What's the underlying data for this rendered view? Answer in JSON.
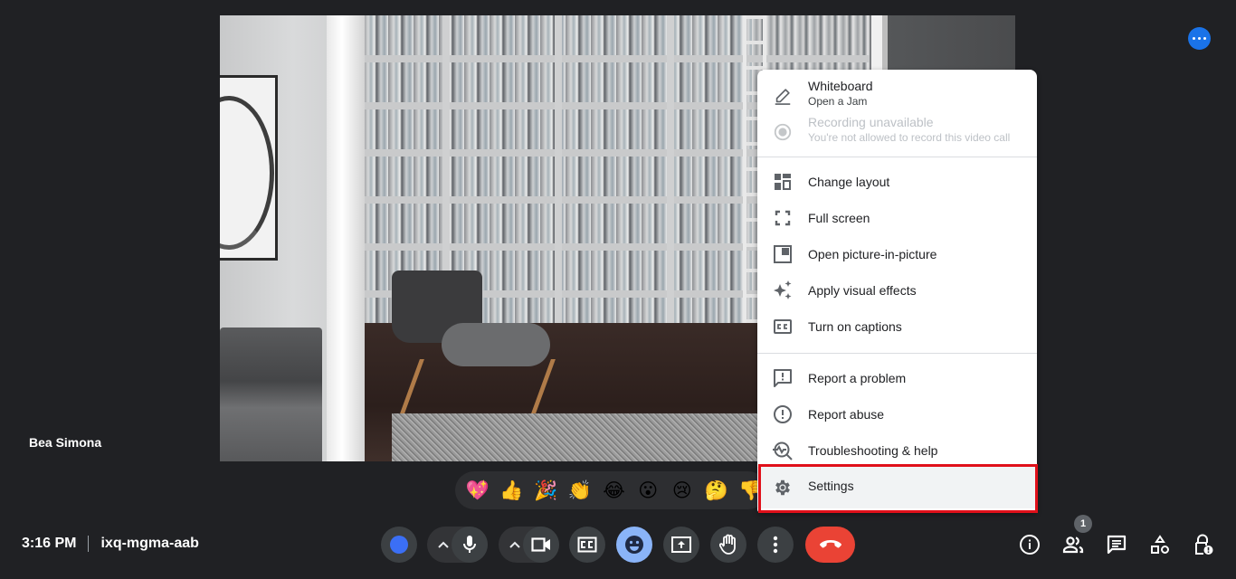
{
  "participant": {
    "name": "Bea Simona"
  },
  "meeting": {
    "time": "3:16 PM",
    "code": "ixq-mgma-aab"
  },
  "colors": {
    "background": "#202124",
    "accent": "#1a73e8",
    "emoji_active": "#8ab4f8",
    "end_call": "#ea4335",
    "highlight": "#e0101a"
  },
  "reactions": [
    {
      "name": "sparkling-heart",
      "glyph": "💖"
    },
    {
      "name": "thumbs-up",
      "glyph": "👍"
    },
    {
      "name": "party-popper",
      "glyph": "🎉"
    },
    {
      "name": "clapping-hands",
      "glyph": "👏"
    },
    {
      "name": "tears-of-joy",
      "glyph": "😂"
    },
    {
      "name": "surprised",
      "glyph": "😮"
    },
    {
      "name": "crying",
      "glyph": "😢"
    },
    {
      "name": "thinking",
      "glyph": "🤔"
    },
    {
      "name": "thumbs-down",
      "glyph": "👎"
    }
  ],
  "menu": {
    "whiteboard": {
      "label": "Whiteboard",
      "sub": "Open a Jam"
    },
    "recording": {
      "label": "Recording unavailable",
      "sub": "You're not allowed to record this video call"
    },
    "change_layout": "Change layout",
    "full_screen": "Full screen",
    "pip": "Open picture-in-picture",
    "visual_effects": "Apply visual effects",
    "captions": "Turn on captions",
    "report_problem": "Report a problem",
    "report_abuse": "Report abuse",
    "troubleshooting": "Troubleshooting & help",
    "settings": "Settings"
  },
  "people_count": "1"
}
